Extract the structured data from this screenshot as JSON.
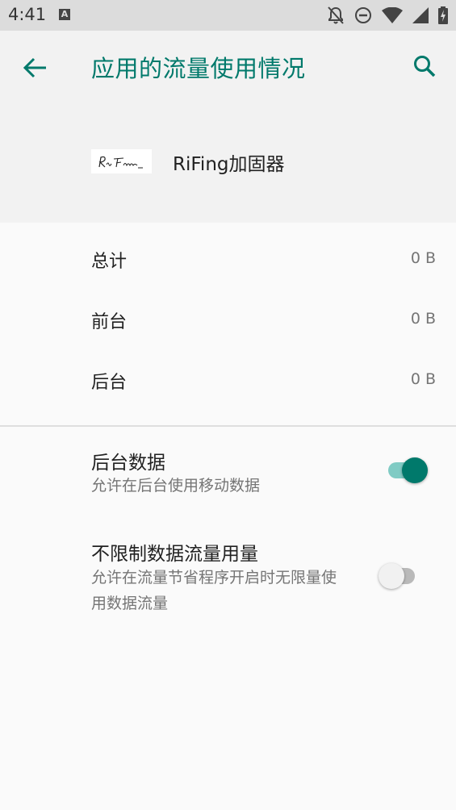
{
  "status_bar": {
    "time": "4:41",
    "icons": [
      "a-notification-icon",
      "bell-off-icon",
      "do-not-disturb-icon",
      "wifi-icon",
      "cell-signal-icon",
      "battery-charging-icon"
    ]
  },
  "toolbar": {
    "title": "应用的流量使用情况",
    "back_icon": "arrow-left-icon",
    "search_icon": "search-icon",
    "accent_color": "#00796b"
  },
  "app": {
    "name": "RiFing加固器"
  },
  "usage": [
    {
      "label": "总计",
      "value": "0 B"
    },
    {
      "label": "前台",
      "value": "0 B"
    },
    {
      "label": "后台",
      "value": "0 B"
    }
  ],
  "settings": [
    {
      "title": "后台数据",
      "summary": "允许在后台使用移动数据",
      "enabled": true
    },
    {
      "title": "不限制数据流量用量",
      "summary": "允许在流量节省程序开启时无限量使用数据流量",
      "enabled": false
    }
  ]
}
